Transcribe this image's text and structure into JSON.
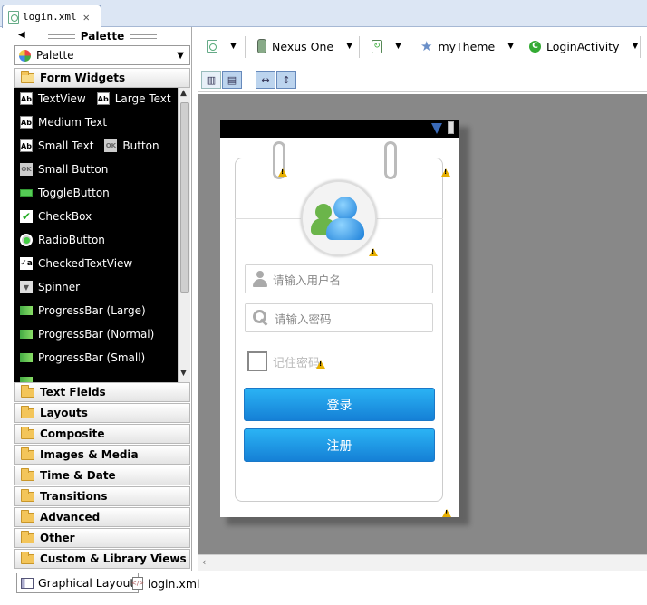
{
  "editor": {
    "tab_label": "login.xml"
  },
  "palette": {
    "title": "Palette",
    "selector_value": "Palette",
    "categories_top": [
      "Form Widgets"
    ],
    "widgets": [
      {
        "icon": "textview-icon",
        "label": "TextView",
        "label2": "Large Text",
        "icon2": "large-text-icon"
      },
      {
        "icon": "medium-text-icon",
        "label": "Medium Text"
      },
      {
        "icon": "small-text-icon",
        "label": "Small Text",
        "label2": "Button",
        "icon2": "button-icon"
      },
      {
        "icon": "small-button-icon",
        "label": "Small Button"
      },
      {
        "icon": "toggle-button-icon",
        "label": "ToggleButton"
      },
      {
        "icon": "checkbox-icon",
        "label": "CheckBox"
      },
      {
        "icon": "radio-button-icon",
        "label": "RadioButton"
      },
      {
        "icon": "checked-textview-icon",
        "label": "CheckedTextView"
      },
      {
        "icon": "spinner-icon",
        "label": "Spinner"
      },
      {
        "icon": "progressbar-large-icon",
        "label": "ProgressBar (Large)"
      },
      {
        "icon": "progressbar-normal-icon",
        "label": "ProgressBar (Normal)"
      },
      {
        "icon": "progressbar-small-icon",
        "label": "ProgressBar (Small)"
      }
    ],
    "categories": [
      "Text Fields",
      "Layouts",
      "Composite",
      "Images & Media",
      "Time & Date",
      "Transitions",
      "Advanced",
      "Other",
      "Custom & Library Views"
    ]
  },
  "toolbar": {
    "device": "Nexus One",
    "theme": "myTheme",
    "activity": "LoginActivity"
  },
  "device": {
    "username_placeholder": "请输入用户名",
    "password_placeholder": "请输入密码",
    "remember_label": "记住密码",
    "login_label": "登录",
    "register_label": "注册"
  },
  "bottom_tabs": [
    "Graphical Layout",
    "login.xml"
  ],
  "colors": {
    "button": "#1a9ae8",
    "canvas": "#888888",
    "widget_bg": "#000000"
  }
}
